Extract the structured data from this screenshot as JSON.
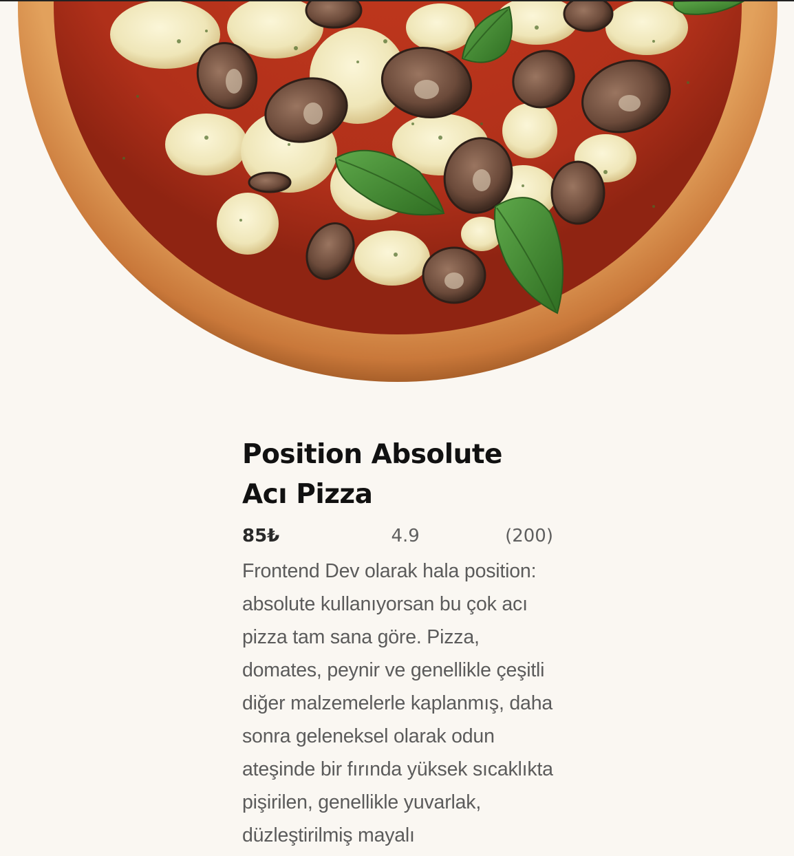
{
  "product": {
    "title": "Position Absolute Acı Pizza",
    "price": "85₺",
    "rating": "4.9",
    "review_count": "(200)",
    "description": "Frontend Dev olarak hala position: absolute kullanıyorsan bu çok acı pizza tam sana göre. Pizza, domates, peynir ve genellikle çeşitli diğer malzemelerle kaplanmış, daha sonra geleneksel olarak odun ateşinde bir fırında yüksek sıcaklıkta pişirilen, genellikle yuvarlak, düzleştirilmiş mayalı"
  },
  "image": {
    "icon": "pizza-image"
  },
  "colors": {
    "background": "#faf7f2",
    "crust": "#d9924a",
    "sauce": "#b8321a",
    "cheese": "#f2ecc6",
    "mushroom": "#6b4a3a",
    "basil": "#3f8a2e"
  }
}
